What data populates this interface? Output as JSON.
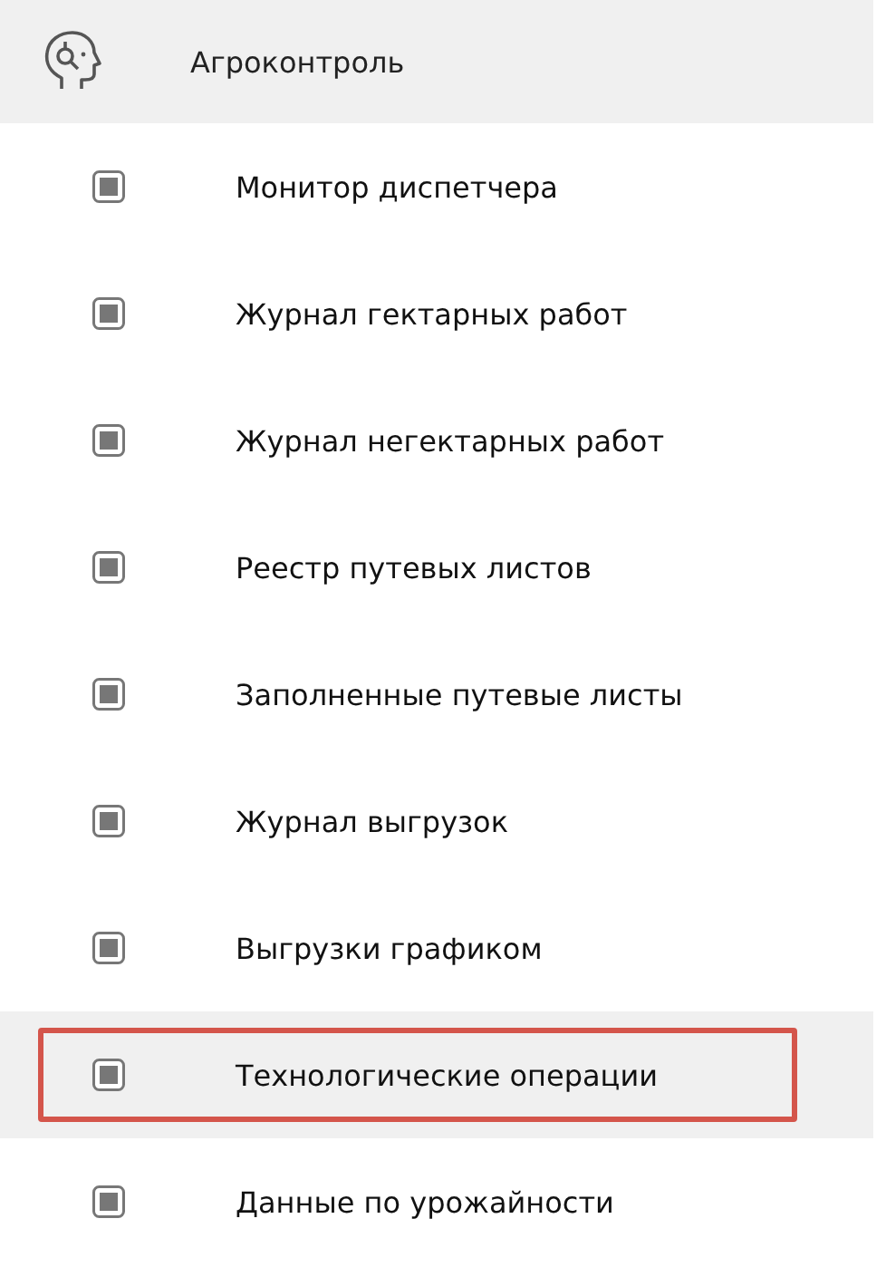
{
  "header": {
    "title": "Агроконтроль"
  },
  "items": [
    {
      "label": "Монитор диспетчера",
      "selected": false,
      "outlined": false
    },
    {
      "label": "Журнал гектарных работ",
      "selected": false,
      "outlined": false
    },
    {
      "label": "Журнал негектарных работ",
      "selected": false,
      "outlined": false
    },
    {
      "label": "Реестр путевых листов",
      "selected": false,
      "outlined": false
    },
    {
      "label": "Заполненные путевые листы",
      "selected": false,
      "outlined": false
    },
    {
      "label": "Журнал выгрузок",
      "selected": false,
      "outlined": false
    },
    {
      "label": "Выгрузки графиком",
      "selected": false,
      "outlined": false
    },
    {
      "label": "Технологические операции",
      "selected": true,
      "outlined": true
    },
    {
      "label": "Данные по урожайности",
      "selected": false,
      "outlined": false
    }
  ]
}
